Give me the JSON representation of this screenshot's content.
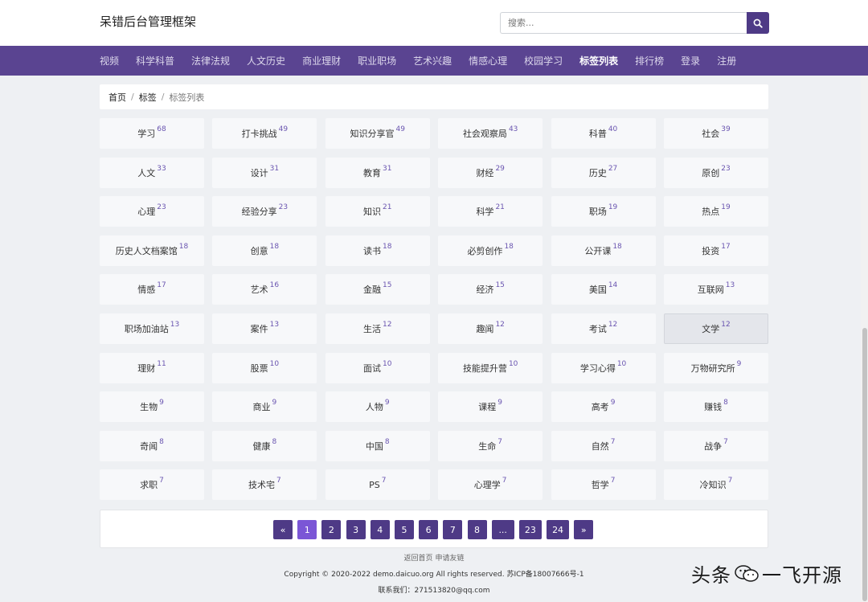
{
  "header": {
    "brand": "呆错后台管理框架",
    "search_placeholder": "搜索..."
  },
  "nav": {
    "items": [
      "视频",
      "科学科普",
      "法律法规",
      "人文历史",
      "商业理财",
      "职业职场",
      "艺术兴趣",
      "情感心理",
      "校园学习",
      "标签列表",
      "排行榜",
      "登录",
      "注册"
    ]
  },
  "breadcrumb": {
    "home": "首页",
    "tag": "标签",
    "current": "标签列表"
  },
  "tags": [
    {
      "name": "学习",
      "count": "68"
    },
    {
      "name": "打卡挑战",
      "count": "49"
    },
    {
      "name": "知识分享官",
      "count": "49"
    },
    {
      "name": "社会观察局",
      "count": "43"
    },
    {
      "name": "科普",
      "count": "40"
    },
    {
      "name": "社会",
      "count": "39"
    },
    {
      "name": "人文",
      "count": "33"
    },
    {
      "name": "设计",
      "count": "31"
    },
    {
      "name": "教育",
      "count": "31"
    },
    {
      "name": "财经",
      "count": "29"
    },
    {
      "name": "历史",
      "count": "27"
    },
    {
      "name": "原创",
      "count": "23"
    },
    {
      "name": "心理",
      "count": "23"
    },
    {
      "name": "经验分享",
      "count": "23"
    },
    {
      "name": "知识",
      "count": "21"
    },
    {
      "name": "科学",
      "count": "21"
    },
    {
      "name": "职场",
      "count": "19"
    },
    {
      "name": "热点",
      "count": "19"
    },
    {
      "name": "历史人文档案馆",
      "count": "18"
    },
    {
      "name": "创意",
      "count": "18"
    },
    {
      "name": "读书",
      "count": "18"
    },
    {
      "name": "必剪创作",
      "count": "18"
    },
    {
      "name": "公开课",
      "count": "18"
    },
    {
      "name": "投资",
      "count": "17"
    },
    {
      "name": "情感",
      "count": "17"
    },
    {
      "name": "艺术",
      "count": "16"
    },
    {
      "name": "金融",
      "count": "15"
    },
    {
      "name": "经济",
      "count": "15"
    },
    {
      "name": "美国",
      "count": "14"
    },
    {
      "name": "互联网",
      "count": "13"
    },
    {
      "name": "职场加油站",
      "count": "13"
    },
    {
      "name": "案件",
      "count": "13"
    },
    {
      "name": "生活",
      "count": "12"
    },
    {
      "name": "趣闻",
      "count": "12"
    },
    {
      "name": "考试",
      "count": "12"
    },
    {
      "name": "文学",
      "count": "12"
    },
    {
      "name": "理财",
      "count": "11"
    },
    {
      "name": "股票",
      "count": "10"
    },
    {
      "name": "面试",
      "count": "10"
    },
    {
      "name": "技能提升营",
      "count": "10"
    },
    {
      "name": "学习心得",
      "count": "10"
    },
    {
      "name": "万物研究所",
      "count": "9"
    },
    {
      "name": "生物",
      "count": "9"
    },
    {
      "name": "商业",
      "count": "9"
    },
    {
      "name": "人物",
      "count": "9"
    },
    {
      "name": "课程",
      "count": "9"
    },
    {
      "name": "高考",
      "count": "9"
    },
    {
      "name": "赚钱",
      "count": "8"
    },
    {
      "name": "奇闻",
      "count": "8"
    },
    {
      "name": "健康",
      "count": "8"
    },
    {
      "name": "中国",
      "count": "8"
    },
    {
      "name": "生命",
      "count": "7"
    },
    {
      "name": "自然",
      "count": "7"
    },
    {
      "name": "战争",
      "count": "7"
    },
    {
      "name": "求职",
      "count": "7"
    },
    {
      "name": "技术宅",
      "count": "7"
    },
    {
      "name": "PS",
      "count": "7"
    },
    {
      "name": "心理学",
      "count": "7"
    },
    {
      "name": "哲学",
      "count": "7"
    },
    {
      "name": "冷知识",
      "count": "7"
    }
  ],
  "pagination": {
    "prev": "«",
    "pages": [
      "1",
      "2",
      "3",
      "4",
      "5",
      "6",
      "7",
      "8",
      "...",
      "23",
      "24"
    ],
    "next": "»",
    "current": "1"
  },
  "footer": {
    "link_home": "返回首页",
    "link_friend": "申请友链",
    "copyright": "Copyright © 2020-2022 demo.daicuo.org All rights reserved. 苏ICP备18007666号-1",
    "contact": "联系我们：271513820@qq.com"
  },
  "watermark": {
    "left": "头条",
    "right": "一飞开源"
  },
  "colors": {
    "nav_bg": "#5a4491",
    "accent": "#4e3a86",
    "active_page": "#7b56d6",
    "tag_count": "#6a55b0"
  }
}
